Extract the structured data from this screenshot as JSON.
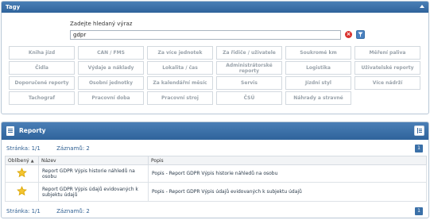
{
  "tagy": {
    "title": "Tagy",
    "search_label": "Zadejte hledaný výraz",
    "search_value": "gdpr",
    "tags": [
      "Kniha jízd",
      "CAN / FMS",
      "Za více jednotek",
      "Za řidiče / uživatele",
      "Soukromé km",
      "Měření paliva",
      "Čidla",
      "Výdaje a náklady",
      "Lokalita / čas",
      "Administrátorské reporty",
      "Logistika",
      "Uživatelské reporty",
      "Doporučené reporty",
      "Osobní jednotky",
      "Za kalendářní měsíc",
      "Servis",
      "Jízdní styl",
      "Více nádrží",
      "Tachograf",
      "Pracovní doba",
      "Pracovní stroj",
      "ČSÚ",
      "Náhrady a stravné"
    ]
  },
  "reporty": {
    "title": "Reporty",
    "page_label": "Stránka: 1/1",
    "records_label": "Záznamů: 2",
    "page_number": "1",
    "columns": {
      "favorite": "Oblíbený",
      "sort_arrow": "▲",
      "name": "Název",
      "description": "Popis"
    },
    "rows": [
      {
        "name": "Report GDPR Výpis historie náhledů na osobu",
        "description": "Popis - Report GDPR Výpis historie náhledů na osobu"
      },
      {
        "name": "Report GDPR Výpis údajů evidovaných k subjektu údajů",
        "description": "Popis - Report GDPR Výpis údajů evidovaných k subjektu údajů"
      }
    ]
  }
}
